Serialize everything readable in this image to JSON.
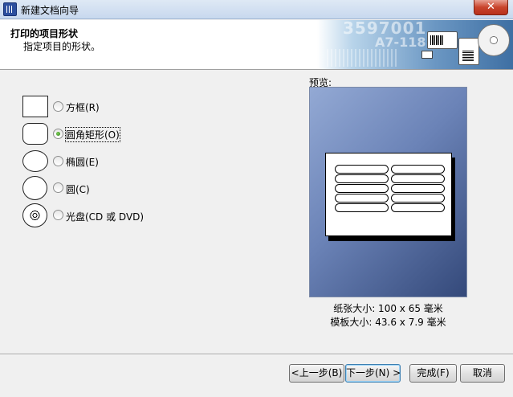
{
  "window": {
    "title": "新建文档向导",
    "close_symbol": "✕"
  },
  "header": {
    "title": "打印的项目形状",
    "subtitle": "指定项目的形状。",
    "banner_text_1": "3597001",
    "banner_text_2": "A7-118"
  },
  "shapes": {
    "selected": "圆角矩形(O)",
    "options": [
      {
        "label": "方框(R)",
        "checked": false
      },
      {
        "label": "圆角矩形(O)",
        "checked": true
      },
      {
        "label": "椭圆(E)",
        "checked": false
      },
      {
        "label": "圆(C)",
        "checked": false
      },
      {
        "label": "光盘(CD 或 DVD)",
        "checked": false
      }
    ]
  },
  "preview": {
    "label": "预览:",
    "paper_size": "纸张大小: 100 x 65 毫米",
    "template_size": "模板大小: 43.6 x 7.9 毫米",
    "label_rows": 5,
    "label_columns": 2
  },
  "buttons": {
    "back": "<上一步(B)",
    "next": "下一步(N) >",
    "finish": "完成(F)",
    "cancel": "取消"
  },
  "colors": {
    "preview_top": "#93a9d4",
    "preview_bottom": "#34497a",
    "radio_selected": "#2d7a14",
    "close_button": "#c9442c"
  }
}
